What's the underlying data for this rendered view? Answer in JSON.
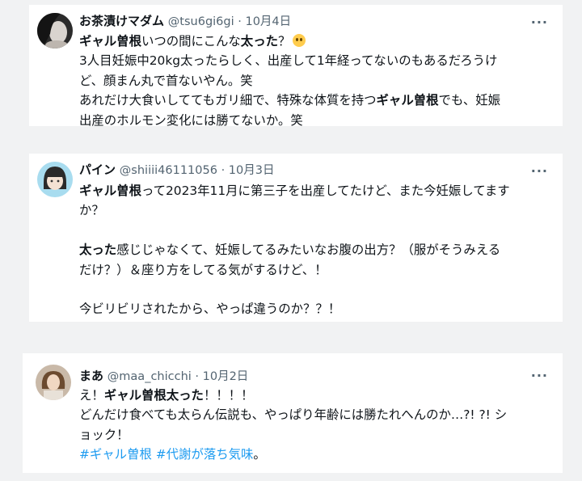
{
  "tweets": [
    {
      "name": "お茶漬けマダム",
      "meta": "@tsu6gi6gi · 10月4日",
      "more": "···",
      "lines": [
        [
          {
            "t": "ギャル曽根",
            "b": true
          },
          {
            "t": "いつの間にこんな"
          },
          {
            "t": "太った",
            "b": true
          },
          {
            "t": "？"
          }
        ],
        [
          {
            "t": "3人目妊娠中20kg太ったらしく、出産して1年経ってないのもあるだろうけ"
          }
        ],
        [
          {
            "t": "ど、顔まん丸で首ないやん。笑"
          }
        ],
        [
          {
            "t": "あれだけ大食いしててもガリ細で、特殊な体質を持つ"
          },
          {
            "t": "ギャル曽根",
            "b": true
          },
          {
            "t": "でも、妊娠"
          }
        ],
        [
          {
            "t": "出産のホルモン変化には勝てないか。笑"
          }
        ]
      ]
    },
    {
      "name": "パイン",
      "meta": "@shiiii46111056 · 10月3日",
      "more": "···",
      "lines": [
        [
          {
            "t": "ギャル曽根",
            "b": true
          },
          {
            "t": "って2023年11月に第三子を出産してたけど、また今妊娠してます"
          }
        ],
        [
          {
            "t": "か？"
          }
        ],
        [],
        [
          {
            "t": "太った",
            "b": true
          },
          {
            "t": "感じじゃなくて、妊娠してるみたいなお腹の出方？（服がそうみえる"
          }
        ],
        [
          {
            "t": "だけ？）＆座り方をしてる気がするけど、！"
          }
        ],
        [],
        [
          {
            "t": "今ビリビリされたから、やっぱ違うのか？？！"
          }
        ]
      ]
    },
    {
      "name": "まあ",
      "meta": "@maa_chicchi · 10月2日",
      "more": "···",
      "lines": [
        [
          {
            "t": "え！"
          },
          {
            "t": "ギャル曽根太った",
            "b": true
          },
          {
            "t": "！！！！"
          }
        ],
        [
          {
            "t": "どんだけ食べても太らん伝説も、やっぱり年齢には勝たれへんのか…?! ?! シ"
          }
        ],
        [
          {
            "t": "ョック！"
          }
        ],
        [
          {
            "t": "#ギャル曽根",
            "h": true
          },
          {
            "t": " "
          },
          {
            "t": "#代謝が落ち気味",
            "h": true
          },
          {
            "t": "。"
          }
        ]
      ]
    }
  ]
}
